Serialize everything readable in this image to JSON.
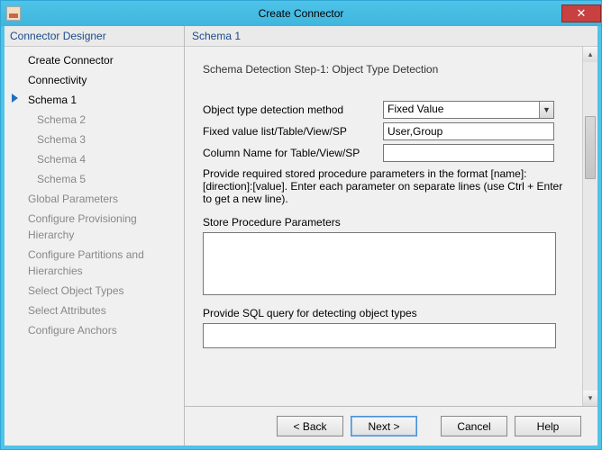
{
  "window": {
    "title": "Create Connector"
  },
  "sidebar": {
    "header": "Connector Designer",
    "items": [
      {
        "label": "Create Connector",
        "enabled": true
      },
      {
        "label": "Connectivity",
        "enabled": true
      },
      {
        "label": "Schema 1",
        "enabled": true,
        "active": true
      },
      {
        "label": "Schema 2",
        "sub": true
      },
      {
        "label": "Schema 3",
        "sub": true
      },
      {
        "label": "Schema 4",
        "sub": true
      },
      {
        "label": "Schema 5",
        "sub": true
      },
      {
        "label": "Global Parameters"
      },
      {
        "label": "Configure Provisioning Hierarchy"
      },
      {
        "label": "Configure Partitions and Hierarchies"
      },
      {
        "label": "Select Object Types"
      },
      {
        "label": "Select Attributes"
      },
      {
        "label": "Configure Anchors"
      }
    ]
  },
  "main": {
    "header": "Schema 1",
    "step_title": "Schema Detection Step-1: Object Type Detection",
    "labels": {
      "method": "Object type detection method",
      "fixed_list": "Fixed value list/Table/View/SP",
      "column_name": "Column Name for Table/View/SP"
    },
    "values": {
      "method": "Fixed Value",
      "fixed_list": "User,Group",
      "column_name": ""
    },
    "help_text": "Provide required stored procedure parameters in the format [name]:[direction]:[value]. Enter each parameter on separate lines (use Ctrl + Enter to get a new line).",
    "sp_params_label": "Store Procedure Parameters",
    "sp_params_value": "",
    "sql_label": "Provide SQL query for detecting object types",
    "sql_value": ""
  },
  "footer": {
    "back": "<  Back",
    "next": "Next  >",
    "cancel": "Cancel",
    "help": "Help"
  }
}
